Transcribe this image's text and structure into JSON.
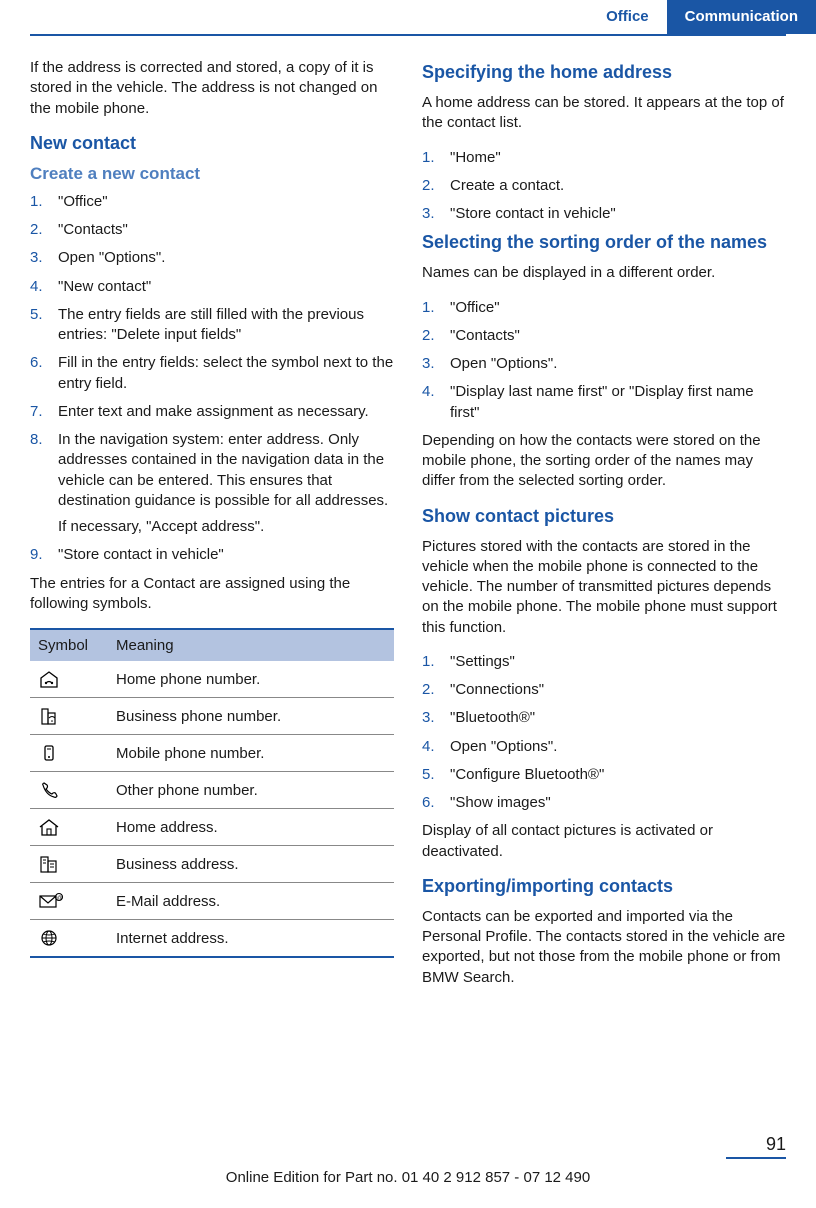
{
  "header": {
    "tab_plain": "Office",
    "tab_active": "Communication"
  },
  "left": {
    "intro": "If the address is corrected and stored, a copy of it is stored in the vehicle. The address is not changed on the mobile phone.",
    "h1_new_contact": "New contact",
    "h2_create": "Create a new contact",
    "steps_create": {
      "s1": "\"Office\"",
      "s2": "\"Contacts\"",
      "s3": "Open \"Options\".",
      "s4": "\"New contact\"",
      "s5": "The entry fields are still filled with the previous entries: \"Delete input fields\"",
      "s6": "Fill in the entry fields: select the symbol next to the entry field.",
      "s7": "Enter text and make assignment as necessary.",
      "s8": "In the navigation system: enter address. Only addresses contained in the navigation data in the vehicle can be entered. This ensures that destination guidance is possible for all addresses.",
      "s8b": "If necessary, \"Accept address\".",
      "s9": "\"Store contact in vehicle\""
    },
    "after_create": "The entries for a Contact are assigned using the following symbols.",
    "table": {
      "head_symbol": "Symbol",
      "head_meaning": "Meaning",
      "rows": {
        "r1": "Home phone number.",
        "r2": "Business phone number.",
        "r3": "Mobile phone number.",
        "r4": "Other phone number.",
        "r5": "Home address.",
        "r6": "Business address.",
        "r7": "E-Mail address.",
        "r8": "Internet address."
      }
    }
  },
  "right": {
    "h1_home": "Specifying the home address",
    "home_intro": "A home address can be stored. It appears at the top of the contact list.",
    "steps_home": {
      "s1": "\"Home\"",
      "s2": "Create a contact.",
      "s3": "\"Store contact in vehicle\""
    },
    "h1_sort": "Selecting the sorting order of the names",
    "sort_intro": "Names can be displayed in a different order.",
    "steps_sort": {
      "s1": "\"Office\"",
      "s2": "\"Contacts\"",
      "s3": "Open \"Options\".",
      "s4": "\"Display last name first\" or \"Display first name first\""
    },
    "sort_note": "Depending on how the contacts were stored on the mobile phone, the sorting order of the names may differ from the selected sorting order.",
    "h1_pictures": "Show contact pictures",
    "pictures_intro": "Pictures stored with the contacts are stored in the vehicle when the mobile phone is connected to the vehicle. The number of transmitted pictures depends on the mobile phone. The mobile phone must support this function.",
    "steps_pictures": {
      "s1": "\"Settings\"",
      "s2": "\"Connections\"",
      "s3": "\"Bluetooth®\"",
      "s4": "Open \"Options\".",
      "s5": "\"Configure Bluetooth®\"",
      "s6": "\"Show images\""
    },
    "pictures_note": "Display of all contact pictures is activated or deactivated.",
    "h1_export": "Exporting/importing contacts",
    "export_text": "Contacts can be exported and imported via the Personal Profile. The contacts stored in the vehicle are exported, but not those from the mobile phone or from BMW Search."
  },
  "footer": {
    "page": "91",
    "edition": "Online Edition for Part no. 01 40 2 912 857 - 07 12 490"
  }
}
